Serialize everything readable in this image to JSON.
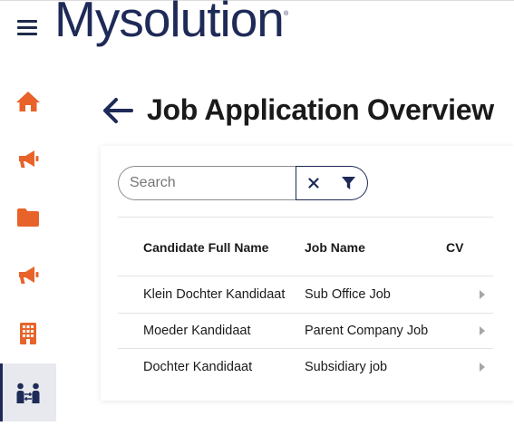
{
  "header": {
    "logo_text": "Mysolution",
    "logo_mark": "®"
  },
  "sidebar": {
    "items": [
      {
        "icon": "home-icon",
        "color": "#e8632a",
        "active": false
      },
      {
        "icon": "megaphone-icon",
        "color": "#e8632a",
        "active": false
      },
      {
        "icon": "folder-icon",
        "color": "#e8632a",
        "active": false
      },
      {
        "icon": "megaphone-icon",
        "color": "#e8632a",
        "active": false
      },
      {
        "icon": "building-icon",
        "color": "#e8632a",
        "active": false
      },
      {
        "icon": "people-exchange-icon",
        "color": "#1e2a57",
        "active": true
      }
    ]
  },
  "page": {
    "title": "Job Application Overview"
  },
  "search": {
    "placeholder": "Search",
    "value": ""
  },
  "table": {
    "columns": [
      "Candidate Full Name",
      "Job Name",
      "CV"
    ],
    "rows": [
      {
        "candidate": "Klein Dochter Kandidaat",
        "job": "Sub Office Job"
      },
      {
        "candidate": "Moeder Kandidaat",
        "job": "Parent Company Job"
      },
      {
        "candidate": "Dochter Kandidaat",
        "job": "Subsidiary job"
      }
    ]
  },
  "colors": {
    "brand_navy": "#1e2a57",
    "accent_orange": "#e8632a"
  }
}
